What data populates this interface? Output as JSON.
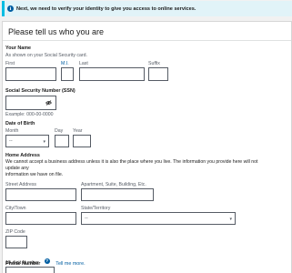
{
  "banner": {
    "icon": "info-icon",
    "text": "Next, we need to verify your identity to give you access to online services."
  },
  "card": {
    "title": "Please tell us who you are"
  },
  "your_name": {
    "heading": "Your Name",
    "hint": "As shown on your Social Security card.",
    "first_label": "First",
    "mi_label": "M.I.",
    "last_label": "Last",
    "suffix_label": "Suffix",
    "first_value": "",
    "mi_value": "",
    "last_value": "",
    "suffix_value": ""
  },
  "ssn": {
    "heading": "Social Security Number (SSN)",
    "value": "",
    "toggle_icon": "eye-slash-icon",
    "example": "Example: 000-00-0000"
  },
  "dob": {
    "heading": "Date of Birth",
    "month_label": "Month",
    "day_label": "Day",
    "year_label": "Year",
    "month_selected": "--",
    "day_value": "",
    "year_value": ""
  },
  "home_address": {
    "heading": "Home Address",
    "desc_line1": "We cannot accept a business address unless it is also the place where you live. The information you provide here will not",
    "desc_line2": "update any",
    "desc_line3": "information we have on file.",
    "street_label": "Street Address",
    "apt_label": "Apartment, Suite, Building, Etc.",
    "city_label": "City/Town",
    "state_label": "State/Territory",
    "state_selected": "--",
    "zip_label": "ZIP Code"
  },
  "phone": {
    "heading": "Phone Number",
    "help_icon": "question-circle-icon",
    "help_link": "Tell me more.",
    "number_label": "10-digit Number"
  }
}
